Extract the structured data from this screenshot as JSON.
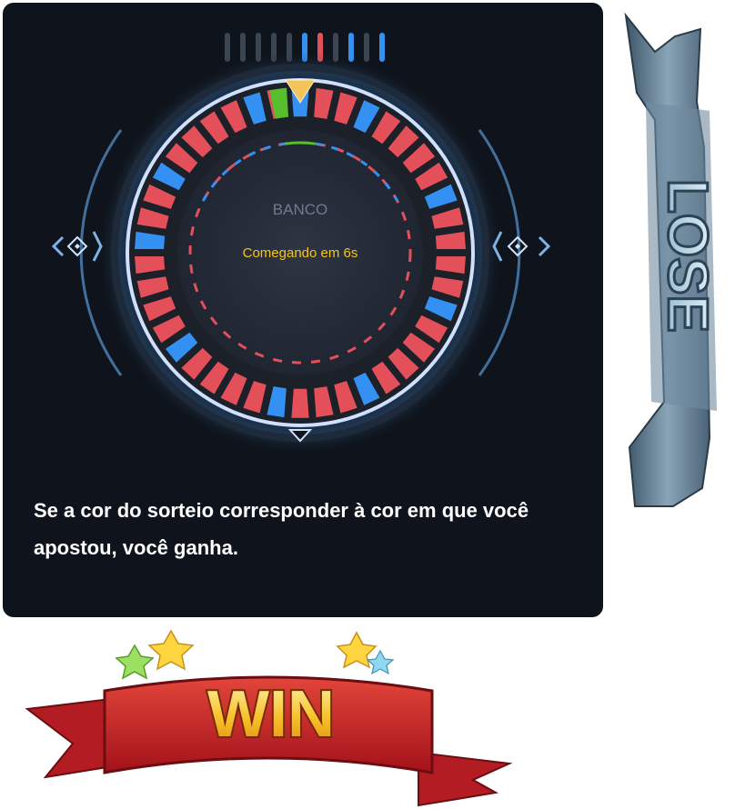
{
  "game": {
    "history": [
      "gray",
      "gray",
      "gray",
      "gray",
      "gray",
      "blue",
      "red",
      "gray",
      "blue",
      "gray",
      "blue"
    ],
    "wheel_label": "BANCO",
    "countdown_text": "Comegando em 6s",
    "winning_segment_color": "green",
    "segment_pattern": [
      "blue",
      "red",
      "red",
      "blue",
      "red",
      "red",
      "red",
      "red",
      "blue",
      "red",
      "red",
      "red",
      "red",
      "blue",
      "red",
      "red",
      "red",
      "red",
      "blue",
      "red",
      "red",
      "red",
      "blue",
      "red",
      "red",
      "red",
      "red",
      "blue",
      "red",
      "red",
      "red",
      "red",
      "blue",
      "red",
      "red",
      "blue",
      "red",
      "red",
      "red",
      "red",
      "blue",
      "red"
    ]
  },
  "rules_text": "Se a cor do sorteio corresponder à cor em que você apostou, você ganha.",
  "banners": {
    "lose_label": "LOSE",
    "win_label": "WIN"
  },
  "colors": {
    "red": "#e4505a",
    "blue": "#3490f2",
    "green": "#57be2e",
    "gray": "#3c4552",
    "panel_bg": "#0f141c",
    "pointer": "#f3c45a",
    "countdown": "#f5c518"
  }
}
